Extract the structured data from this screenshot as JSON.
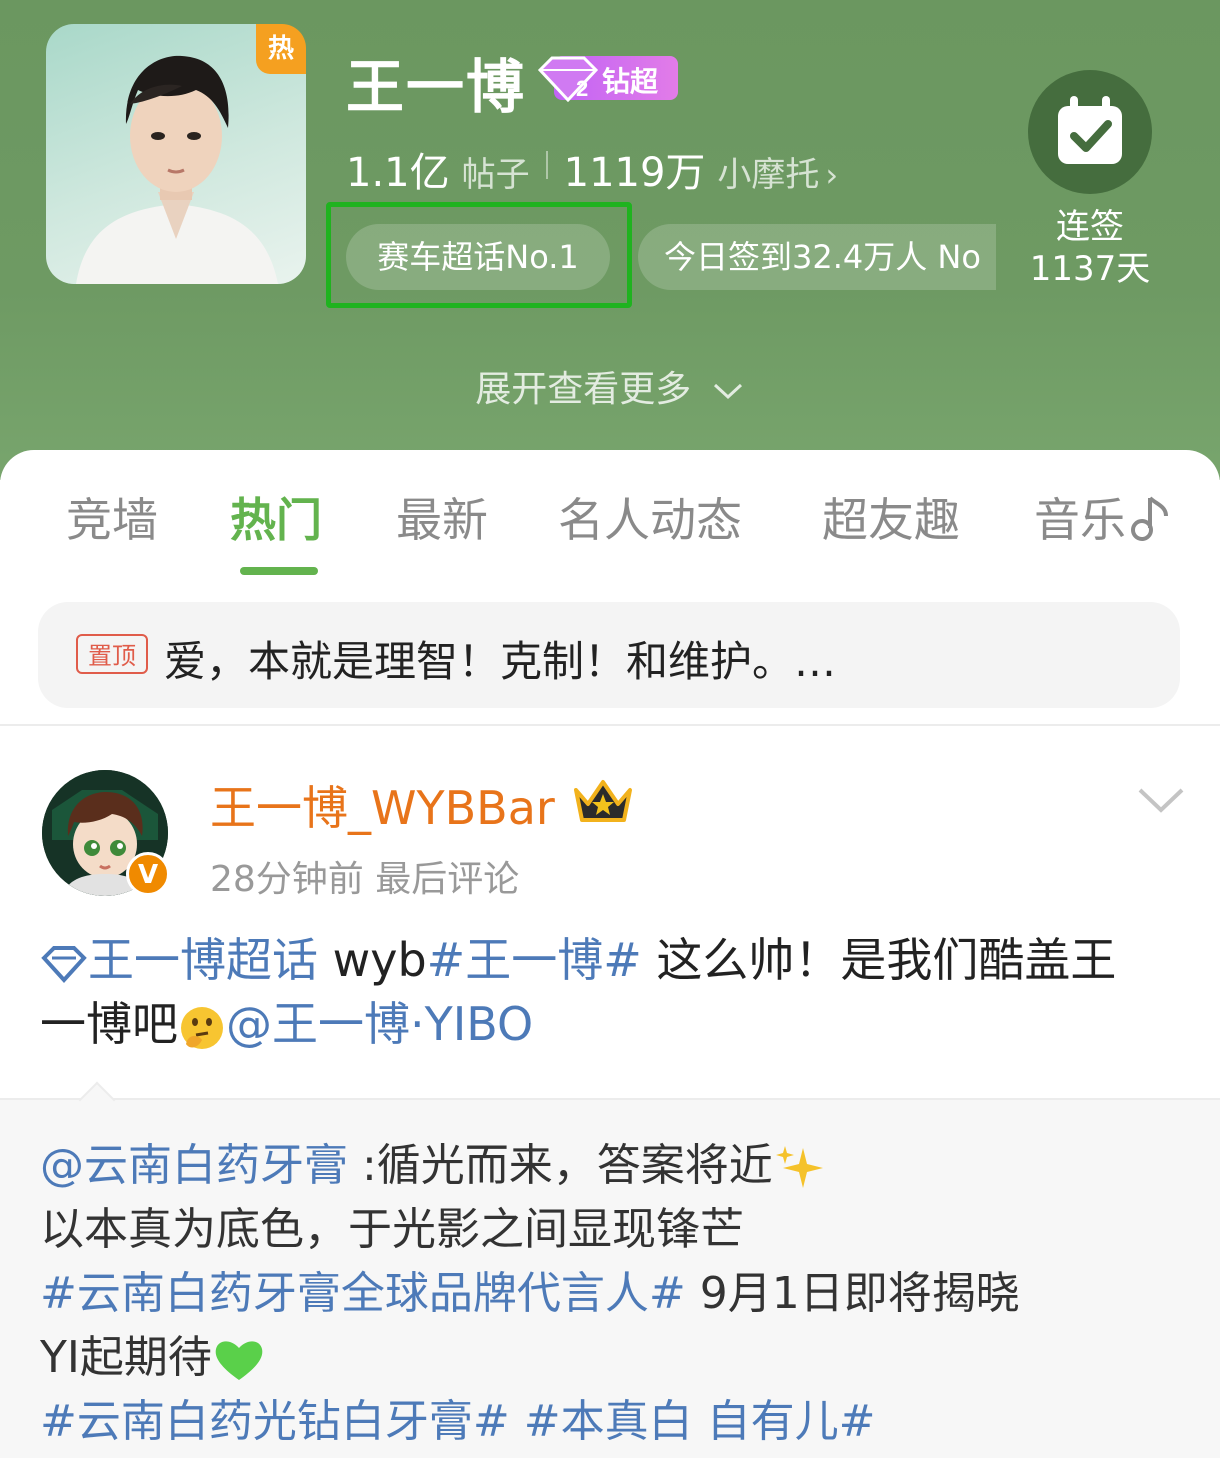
{
  "colors": {
    "header_bg": "#6b9760",
    "accent_green": "#63b34e",
    "highlight_border": "#1fb31f",
    "author_orange": "#e8741a",
    "link_blue": "#4d7ab8",
    "pinned_red": "#e05c4a"
  },
  "header": {
    "hot_badge": "热",
    "title": "王一博",
    "level_badge": {
      "level": "2",
      "label": "钻超"
    },
    "stats": {
      "posts_value": "1.1亿",
      "posts_label": "帖子",
      "fans_value": "1119万",
      "fans_label": "小摩托"
    },
    "rank_pill": "赛车超话No.1",
    "checkin_pill": "今日签到32.4万人 No",
    "checkin": {
      "line1": "连签",
      "line2": "1137天"
    },
    "expand_label": "展开查看更多"
  },
  "tabs": [
    {
      "label": "竞墙",
      "active": false
    },
    {
      "label": "热门",
      "active": true
    },
    {
      "label": "最新",
      "active": false
    },
    {
      "label": "名人动态",
      "active": false
    },
    {
      "label": "超友趣",
      "active": false
    },
    {
      "label": "音乐",
      "active": false
    }
  ],
  "pinned": {
    "tag": "置顶",
    "text": "爱，本就是理智！克制！和维护。…"
  },
  "post": {
    "author": "王一博_WYBBar",
    "vip_badge": "V",
    "time": "28分钟前",
    "meta_label": "最后评论",
    "body": {
      "topic_link": "王一博超话",
      "text1": " wyb",
      "hashtag": "#王一博#",
      "text2": " 这么帅！是我们酷盖王",
      "text3": "一博吧",
      "mention": "@王一博·YIBO"
    },
    "repost": {
      "mention": "@云南白药牙膏",
      "line1_text": " :循光而来，答案将近",
      "line2": "以本真为底色，于光影之间显现锋芒",
      "line3_tag": "#云南白药牙膏全球品牌代言人#",
      "line3_text": " 9月1日即将揭晓",
      "line4_text": "YI起期待",
      "line5_tag1": "#云南白药光钻白牙膏#",
      "line5_tag2": "#本真白 自有儿#"
    }
  },
  "icons": [
    "hot-badge",
    "diamond-level-icon",
    "chevron-right-icon",
    "calendar-check-icon",
    "chevron-down-icon",
    "music-note-icon",
    "crown-icon",
    "vip-v-icon",
    "topic-diamond-icon",
    "thinking-face-icon",
    "sparkles-icon",
    "green-heart-icon"
  ]
}
